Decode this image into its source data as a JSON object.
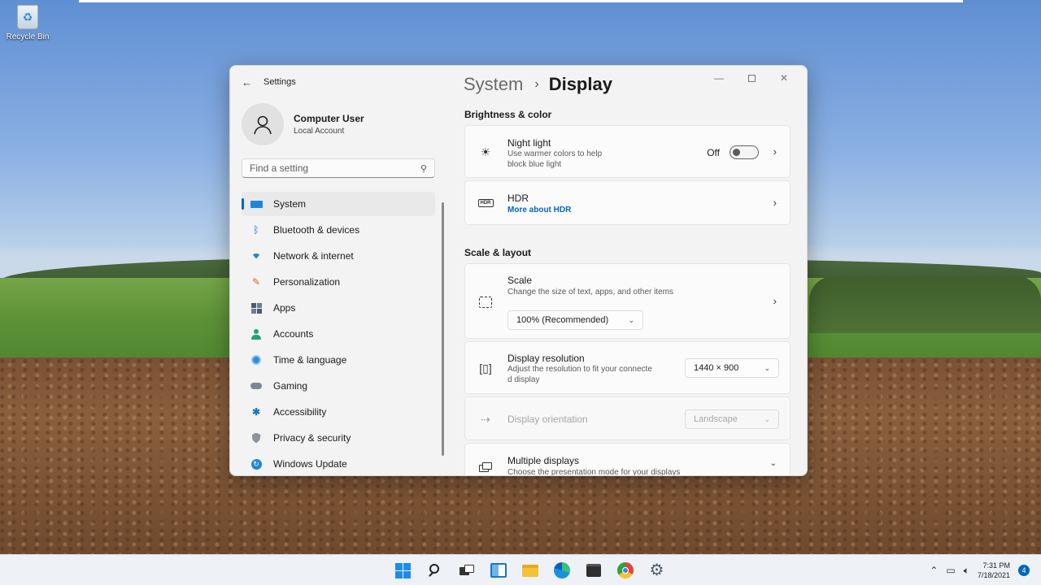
{
  "desktop": {
    "icons": [
      {
        "label": "Recycle Bin",
        "icon": "recycle-bin-icon"
      }
    ]
  },
  "window": {
    "title": "Settings",
    "back_icon": "back-arrow-icon",
    "controls": {
      "minimize": "minimize-icon",
      "maximize": "maximize-icon",
      "close": "close-icon"
    }
  },
  "profile": {
    "name": "Computer User",
    "account_type": "Local Account",
    "avatar_icon": "person-icon"
  },
  "search": {
    "placeholder": "Find a setting",
    "icon": "search-icon"
  },
  "nav": {
    "items": [
      {
        "label": "System",
        "icon": "display-icon",
        "active": true
      },
      {
        "label": "Bluetooth & devices",
        "icon": "bluetooth-icon"
      },
      {
        "label": "Network & internet",
        "icon": "wifi-icon"
      },
      {
        "label": "Personalization",
        "icon": "brush-icon"
      },
      {
        "label": "Apps",
        "icon": "apps-icon"
      },
      {
        "label": "Accounts",
        "icon": "account-icon"
      },
      {
        "label": "Time & language",
        "icon": "globe-clock-icon"
      },
      {
        "label": "Gaming",
        "icon": "gamepad-icon"
      },
      {
        "label": "Accessibility",
        "icon": "accessibility-icon"
      },
      {
        "label": "Privacy & security",
        "icon": "shield-icon"
      },
      {
        "label": "Windows Update",
        "icon": "update-icon"
      }
    ]
  },
  "breadcrumb": {
    "parent": "System",
    "separator": "›",
    "current": "Display"
  },
  "sections": {
    "brightness": {
      "title": "Brightness & color",
      "night_light": {
        "title": "Night light",
        "subtitle_line1": "Use warmer colors to help",
        "subtitle_line2": "block blue light",
        "toggle_state": "Off",
        "icon": "brightness-icon"
      },
      "hdr": {
        "title": "HDR",
        "link": "More about HDR",
        "icon": "hdr-icon"
      }
    },
    "scale_layout": {
      "title": "Scale & layout",
      "scale": {
        "title": "Scale",
        "subtitle": "Change the size of text, apps, and other items",
        "value": "100% (Recommended)",
        "icon": "scale-icon"
      },
      "resolution": {
        "title": "Display resolution",
        "subtitle_line1": "Adjust the resolution to fit your connecte",
        "subtitle_line2": "d display",
        "value": "1440 × 900",
        "icon": "resolution-icon"
      },
      "orientation": {
        "title": "Display orientation",
        "value": "Landscape",
        "icon": "orientation-icon",
        "disabled": true
      },
      "multiple": {
        "title": "Multiple displays",
        "subtitle": "Choose the presentation mode for your displays",
        "icon": "multiple-displays-icon"
      }
    }
  },
  "taskbar": {
    "apps": [
      {
        "name": "start-button",
        "icon": "windows-logo-icon"
      },
      {
        "name": "search-button",
        "icon": "search-icon"
      },
      {
        "name": "task-view-button",
        "icon": "task-view-icon"
      },
      {
        "name": "widgets-button",
        "icon": "widgets-icon"
      },
      {
        "name": "file-explorer-button",
        "icon": "folder-icon"
      },
      {
        "name": "edge-button",
        "icon": "edge-icon"
      },
      {
        "name": "store-button",
        "icon": "store-icon"
      },
      {
        "name": "chrome-button",
        "icon": "chrome-icon"
      },
      {
        "name": "settings-button",
        "icon": "gear-icon"
      }
    ],
    "tray": {
      "time": "7:31 PM",
      "date": "7/18/2021",
      "notification_count": "4"
    }
  },
  "colors": {
    "accent": "#0067c0",
    "window_bg": "#f3f3f3",
    "card_bg": "#fbfbfb",
    "taskbar_bg": "#eef1f6"
  }
}
